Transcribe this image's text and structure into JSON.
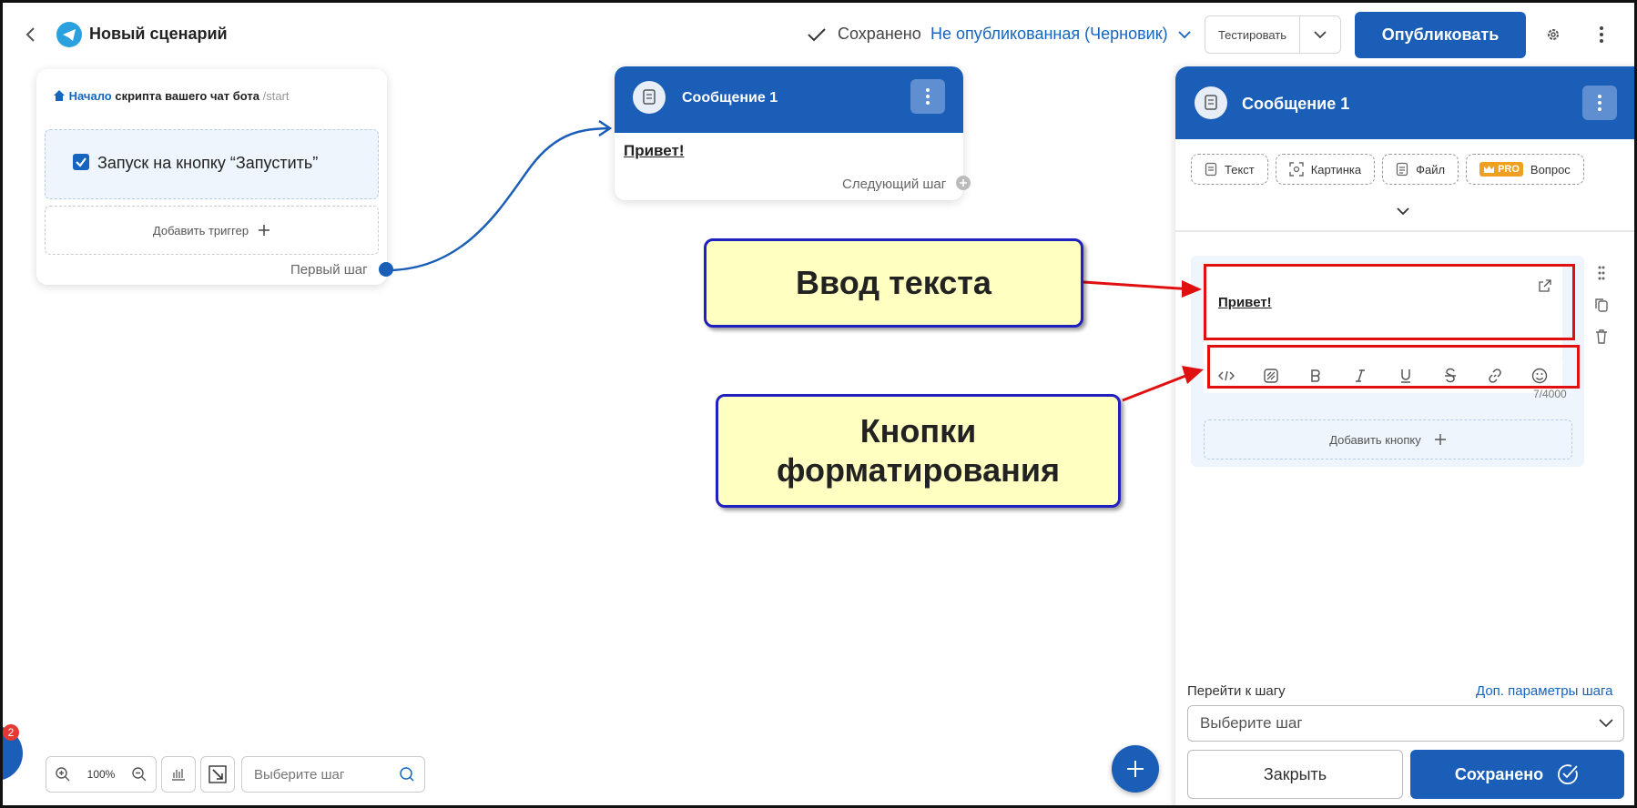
{
  "header": {
    "title": "Новый сценарий",
    "saved": "Сохранено",
    "status": "Не опубликованная (Черновик)",
    "test_label": "Тестировать",
    "publish_label": "Опубликовать"
  },
  "start_card": {
    "prefix": "Начало",
    "text": " скрипта вашего чат бота",
    "command": " /start",
    "trigger_label": "Запуск на кнопку “Запустить”",
    "add_trigger": "Добавить триггер",
    "first_step": "Первый шаг"
  },
  "message_card": {
    "title": "Сообщение 1",
    "text": "Привет!",
    "next_step": "Следующий шаг"
  },
  "panel": {
    "title": "Сообщение 1",
    "chips": [
      {
        "label": "Текст",
        "icon": "text-icon"
      },
      {
        "label": "Картинка",
        "icon": "image-icon"
      },
      {
        "label": "Файл",
        "icon": "file-icon"
      },
      {
        "label": "Вопрос",
        "icon": "crown-icon",
        "pro": "PRO"
      }
    ],
    "editor_text": "Привет!",
    "counter": "7/4000",
    "add_button": "Добавить кнопку",
    "goto_label": "Перейти к шагу",
    "goto_link": "Доп. параметры шага",
    "select_placeholder": "Выберите шаг",
    "close_label": "Закрыть",
    "save_label": "Сохранено"
  },
  "toolbar": {
    "zoom": "100%",
    "search_placeholder": "Выберите шаг"
  },
  "notification_count": "2",
  "annotations": {
    "text_input": "Ввод текста",
    "format_buttons_line1": "Кнопки",
    "format_buttons_line2": "форматирования"
  },
  "colors": {
    "primary": "#1a5eb7",
    "callout_fill": "#ffffc2",
    "callout_border": "#2020c0",
    "highlight": "#e01010"
  }
}
